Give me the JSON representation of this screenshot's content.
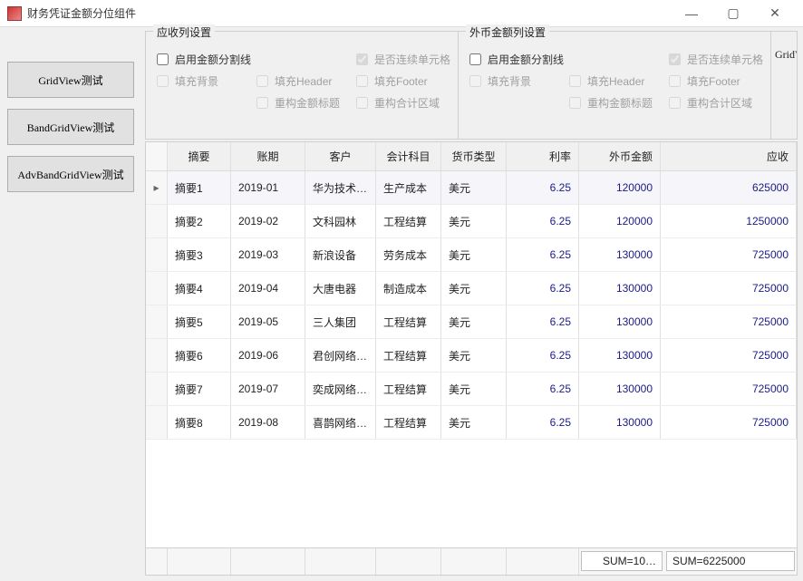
{
  "window": {
    "title": "财务凭证金额分位组件",
    "buttons": {
      "min": "—",
      "max": "▢",
      "close": "✕"
    }
  },
  "side_buttons": {
    "gridview": "GridView测试",
    "bandgridview": "BandGridView测试",
    "advbandgridview": "AdvBandGridView测试"
  },
  "group_receivable": {
    "legend": "应收列设置",
    "checks": {
      "enable_split": "启用金额分割线",
      "continuous_cells": "是否连续单元格",
      "fill_bg": "填充背景",
      "fill_header": "填充Header",
      "fill_footer": "填充Footer",
      "rebuild_title": "重构金额标题",
      "rebuild_sum": "重构合计区域"
    }
  },
  "group_fx": {
    "legend": "外币金额列设置",
    "checks": {
      "enable_split": "启用金额分割线",
      "continuous_cells": "是否连续单元格",
      "fill_bg": "填充背景",
      "fill_header": "填充Header",
      "fill_footer": "填充Footer",
      "rebuild_title": "重构金额标题",
      "rebuild_sum": "重构合计区域"
    }
  },
  "group_extra_label": "GridVi",
  "grid": {
    "columns": {
      "summary": "摘要",
      "period": "账期",
      "client": "客户",
      "subject": "会计科目",
      "currency": "货币类型",
      "rate": "利率",
      "fxamount": "外币金额",
      "receivable": "应收"
    },
    "rows": [
      {
        "indicator": "▸",
        "summary": "摘要1",
        "period": "2019-01",
        "client": "华为技术…",
        "subject": "生产成本",
        "currency": "美元",
        "rate": "6.25",
        "fxamount": "120000",
        "receivable": "625000"
      },
      {
        "indicator": "",
        "summary": "摘要2",
        "period": "2019-02",
        "client": "文科园林",
        "subject": "工程结算",
        "currency": "美元",
        "rate": "6.25",
        "fxamount": "120000",
        "receivable": "1250000"
      },
      {
        "indicator": "",
        "summary": "摘要3",
        "period": "2019-03",
        "client": "新浪设备",
        "subject": "劳务成本",
        "currency": "美元",
        "rate": "6.25",
        "fxamount": "130000",
        "receivable": "725000"
      },
      {
        "indicator": "",
        "summary": "摘要4",
        "period": "2019-04",
        "client": "大唐电器",
        "subject": "制造成本",
        "currency": "美元",
        "rate": "6.25",
        "fxamount": "130000",
        "receivable": "725000"
      },
      {
        "indicator": "",
        "summary": "摘要5",
        "period": "2019-05",
        "client": "三人集团",
        "subject": "工程结算",
        "currency": "美元",
        "rate": "6.25",
        "fxamount": "130000",
        "receivable": "725000"
      },
      {
        "indicator": "",
        "summary": "摘要6",
        "period": "2019-06",
        "client": "君创网络…",
        "subject": "工程结算",
        "currency": "美元",
        "rate": "6.25",
        "fxamount": "130000",
        "receivable": "725000"
      },
      {
        "indicator": "",
        "summary": "摘要7",
        "period": "2019-07",
        "client": "奕成网络…",
        "subject": "工程结算",
        "currency": "美元",
        "rate": "6.25",
        "fxamount": "130000",
        "receivable": "725000"
      },
      {
        "indicator": "",
        "summary": "摘要8",
        "period": "2019-08",
        "client": "喜鹊网络…",
        "subject": "工程结算",
        "currency": "美元",
        "rate": "6.25",
        "fxamount": "130000",
        "receivable": "725000"
      }
    ],
    "footer": {
      "sum_fx": "SUM=10…",
      "sum_receivable": "SUM=6225000"
    }
  }
}
